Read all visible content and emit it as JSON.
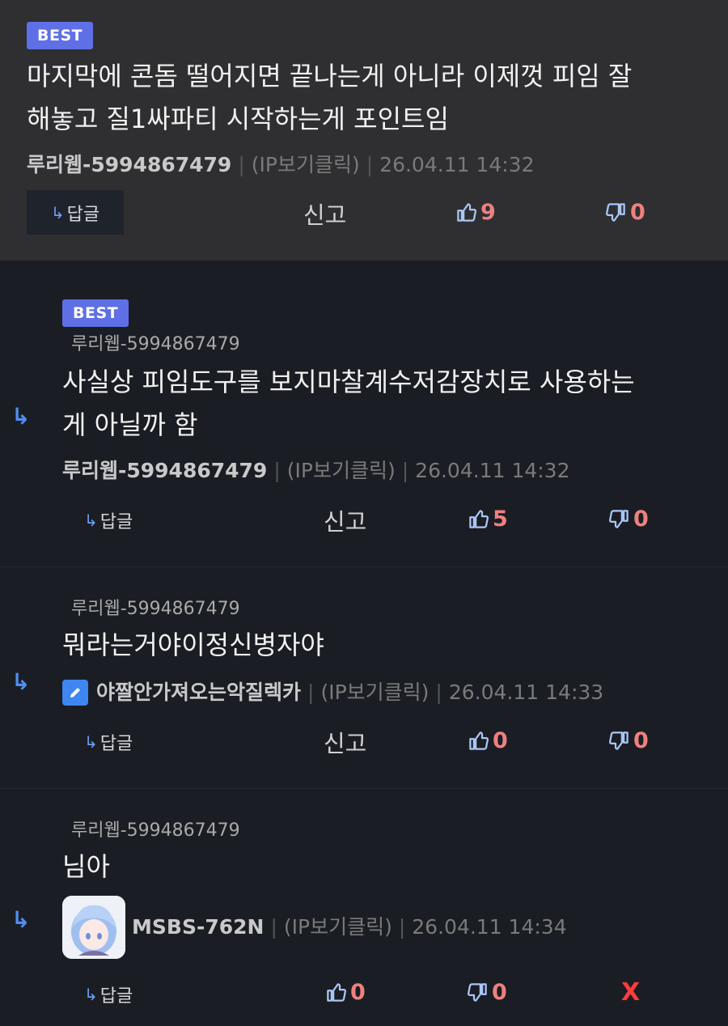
{
  "icons": {
    "thread": "reply-arrow-icon",
    "reply": "reply-arrow-icon",
    "up": "thumbs-up-icon",
    "down": "thumbs-down-icon",
    "pencil": "pencil-icon"
  },
  "colors": {
    "best_badge": "#5f6fe6",
    "vote_count": "#ee8080",
    "x_mark": "#ff3b3b",
    "thread_arrow": "#4f8ef0"
  },
  "comments": [
    {
      "badge": "BEST",
      "text": "마지막에 콘돔 떨어지면 끝나는게 아니라 이제껏 피임 잘\n해놓고 질1싸파티 시작하는게 포인트임",
      "author": "루리웹-5994867479",
      "ip": "(IP보기클릭)",
      "date": "26.04.11 14:32",
      "reply_label": "답글",
      "report_label": "신고",
      "upvotes": "9",
      "downvotes": "0",
      "separator": "|"
    },
    {
      "badge": "BEST",
      "target_user": "루리웹-5994867479",
      "text": "사실상 피임도구를 보지마찰계수저감장치로 사용하는\n게 아닐까 함",
      "author": "루리웹-5994867479",
      "ip": "(IP보기클릭)",
      "date": "26.04.11 14:32",
      "reply_label": "답글",
      "report_label": "신고",
      "upvotes": "5",
      "downvotes": "0",
      "separator": "|"
    },
    {
      "target_user": "루리웹-5994867479",
      "text": "뭐라는거야이정신병자야",
      "author": "야짤안가져오는악질렉카",
      "ip": "(IP보기클릭)",
      "date": "26.04.11 14:33",
      "reply_label": "답글",
      "report_label": "신고",
      "upvotes": "0",
      "downvotes": "0",
      "separator": "|"
    },
    {
      "target_user": "루리웹-5994867479",
      "text": "님아",
      "author": "MSBS-762N",
      "ip": "(IP보기클릭)",
      "date": "26.04.11 14:34",
      "reply_label": "답글",
      "upvotes": "0",
      "downvotes": "0",
      "delete_label": "X",
      "separator": "|"
    }
  ]
}
